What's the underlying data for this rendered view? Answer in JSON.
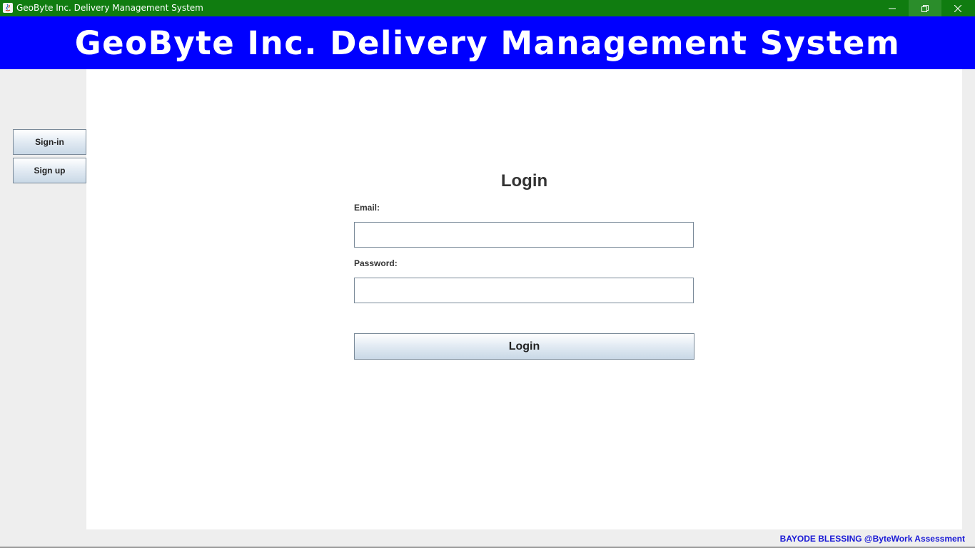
{
  "window": {
    "title": "GeoByte Inc. Delivery Management System",
    "titlebar_color": "#107c10",
    "controls": [
      "minimize-icon",
      "restore-icon",
      "close-icon"
    ]
  },
  "banner": {
    "title": "GeoByte Inc. Delivery Management System",
    "background": "#0000ff"
  },
  "sidebar": {
    "items": [
      {
        "label": "Sign-in"
      },
      {
        "label": "Sign up"
      }
    ]
  },
  "login_form": {
    "heading": "Login",
    "email_label": "Email:",
    "email_value": "",
    "password_label": "Password:",
    "password_value": "",
    "submit_label": "Login"
  },
  "footer": {
    "credit": "BAYODE BLESSING @ByteWork Assessment",
    "credit_color": "#1a1ad6"
  }
}
